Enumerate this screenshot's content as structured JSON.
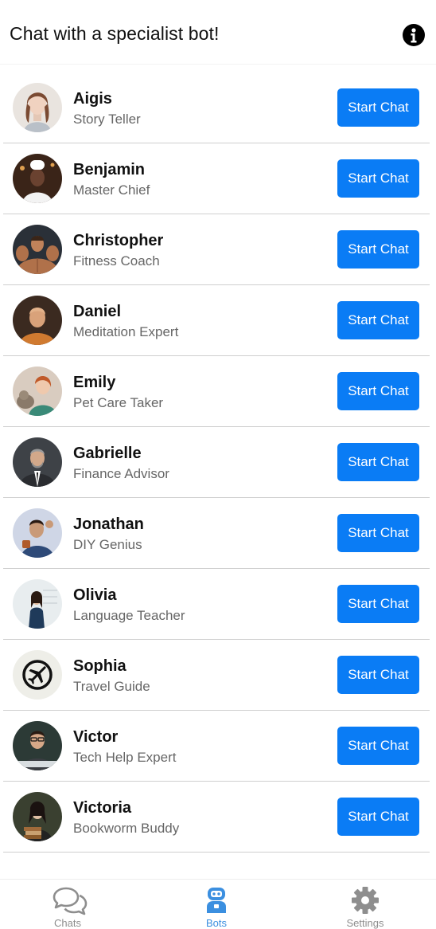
{
  "header": {
    "title": "Chat with a specialist bot!",
    "info_icon": "info-icon"
  },
  "bots": [
    {
      "name": "Aigis",
      "role": "Story Teller",
      "button": "Start Chat",
      "avatar": "robot-woman-portrait"
    },
    {
      "name": "Benjamin",
      "role": "Master Chief",
      "button": "Start Chat",
      "avatar": "chef-portrait"
    },
    {
      "name": "Christopher",
      "role": "Fitness Coach",
      "button": "Start Chat",
      "avatar": "bodybuilder-portrait"
    },
    {
      "name": "Daniel",
      "role": "Meditation Expert",
      "button": "Start Chat",
      "avatar": "monk-portrait"
    },
    {
      "name": "Emily",
      "role": "Pet Care Taker",
      "button": "Start Chat",
      "avatar": "woman-with-cat-portrait"
    },
    {
      "name": "Gabrielle",
      "role": "Finance Advisor",
      "button": "Start Chat",
      "avatar": "businessman-portrait"
    },
    {
      "name": "Jonathan",
      "role": "DIY Genius",
      "button": "Start Chat",
      "avatar": "handyman-portrait"
    },
    {
      "name": "Olivia",
      "role": "Language Teacher",
      "button": "Start Chat",
      "avatar": "teacher-portrait"
    },
    {
      "name": "Sophia",
      "role": "Travel Guide",
      "button": "Start Chat",
      "avatar": "airplane-icon"
    },
    {
      "name": "Victor",
      "role": "Tech Help Expert",
      "button": "Start Chat",
      "avatar": "tech-guy-portrait"
    },
    {
      "name": "Victoria",
      "role": "Bookworm Buddy",
      "button": "Start Chat",
      "avatar": "woman-with-books-portrait"
    }
  ],
  "tabs": [
    {
      "label": "Chats",
      "icon": "chat-bubbles-icon",
      "active": false
    },
    {
      "label": "Bots",
      "icon": "robot-icon",
      "active": true
    },
    {
      "label": "Settings",
      "icon": "gear-icon",
      "active": false
    }
  ],
  "colors": {
    "accent": "#0a7cf5",
    "active_tab": "#3b8fe0",
    "inactive_tab": "#8e8e8e"
  }
}
